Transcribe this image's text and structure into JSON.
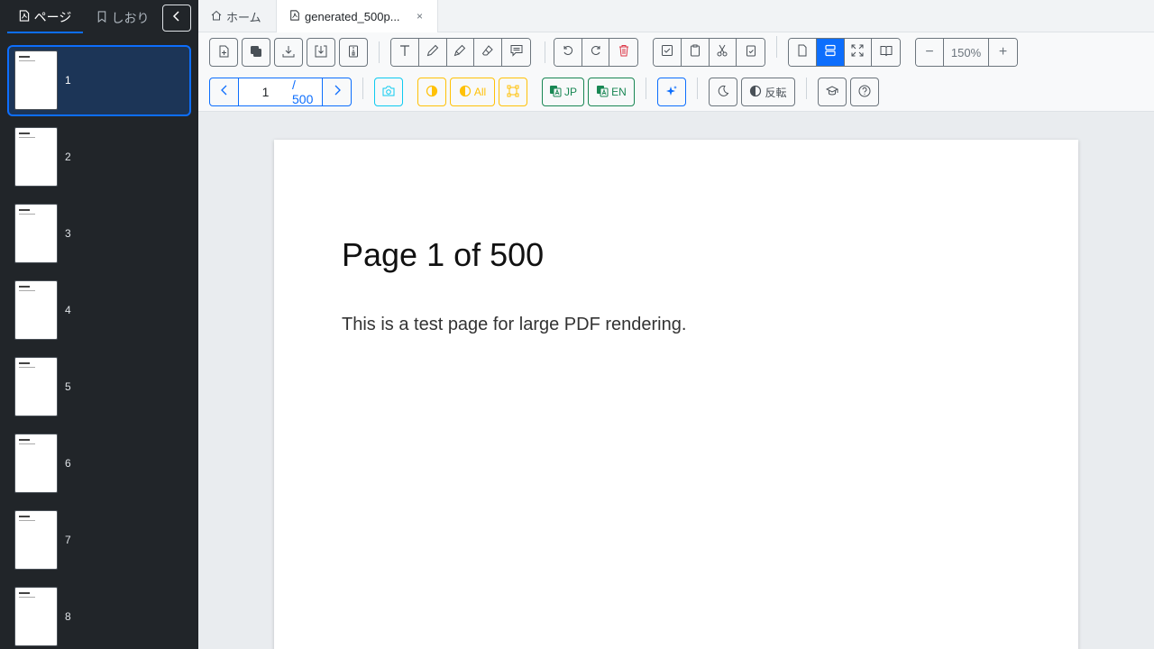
{
  "sidebar": {
    "tabs": [
      {
        "label": "ページ",
        "icon": "file-pdf-icon",
        "active": true
      },
      {
        "label": "しおり",
        "icon": "bookmark-icon",
        "active": false
      }
    ],
    "collapse_icon": "chevron-left-icon",
    "thumbnails": [
      "1",
      "2",
      "3",
      "4",
      "5",
      "6",
      "7",
      "8"
    ],
    "active_thumbnail": "1"
  },
  "tabs": {
    "home_label": "ホーム",
    "file_label": "generated_500p...",
    "close_label": "×"
  },
  "toolbar": {
    "file_group": [
      "file-plus-icon",
      "files-icon",
      "download-icon",
      "save-icon",
      "file-zip-icon"
    ],
    "annotation_group": [
      "text-icon",
      "pen-icon",
      "highlighter-icon",
      "eraser-icon",
      "comment-icon"
    ],
    "rotate_group": [
      "rotate-left-icon",
      "rotate-right-icon",
      "trash-icon"
    ],
    "clipboard_group": [
      "select-icon",
      "copy-icon",
      "cut-icon",
      "paste-icon"
    ],
    "view_group": [
      "single-page-icon",
      "continuous-scroll-icon",
      "fullscreen-icon",
      "book-view-icon"
    ],
    "zoom": {
      "value": "150%",
      "minus": "−",
      "plus": "+"
    },
    "pager": {
      "current": "1",
      "total": "/ 500"
    },
    "buttons": {
      "contrast_all_label": "All",
      "translate_jp_label": "JP",
      "translate_en_label": "EN",
      "invert_label": "反転"
    }
  },
  "document": {
    "title": "Page 1 of 500",
    "body": "This is a test page for large PDF rendering."
  },
  "colors": {
    "primary": "#0d6efd",
    "sidebar_bg": "#212529",
    "warning": "#ffc107",
    "success": "#198754",
    "info": "#0dcaf0",
    "danger": "#dc3545"
  }
}
